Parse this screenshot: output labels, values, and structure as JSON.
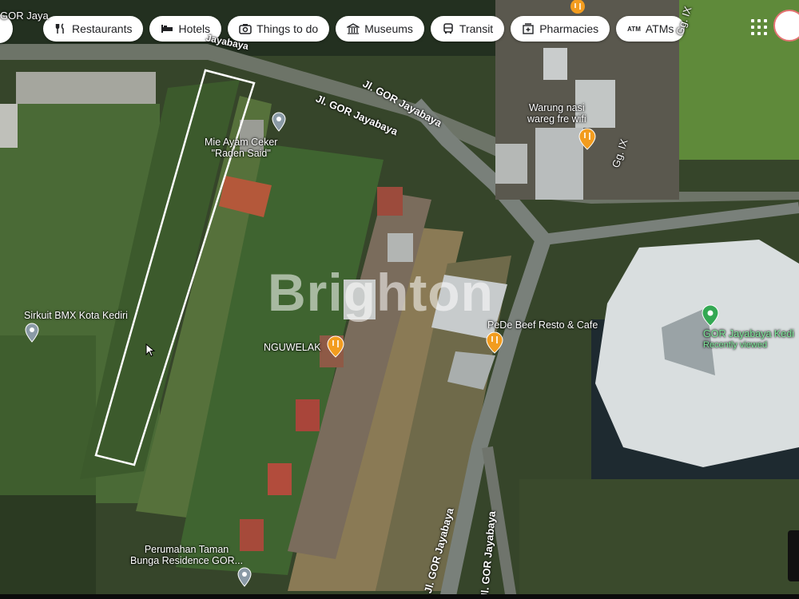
{
  "filters": [
    {
      "label": "Restaurants",
      "icon": "fork-knife-icon"
    },
    {
      "label": "Hotels",
      "icon": "bed-icon"
    },
    {
      "label": "Things to do",
      "icon": "camera-icon"
    },
    {
      "label": "Museums",
      "icon": "museum-icon"
    },
    {
      "label": "Transit",
      "icon": "bus-icon"
    },
    {
      "label": "Pharmacies",
      "icon": "pharmacy-icon"
    },
    {
      "label": "ATMs",
      "icon": "atm-icon"
    }
  ],
  "atm_glyph": "ATM",
  "top_left_fragment": "GOR Jaya",
  "roads": {
    "gor_jayabaya_top_fragment": "Jayabaya",
    "gor_jayabaya_1": "Jl. GOR Jayabaya",
    "gor_jayabaya_2": "Jl. GOR Jayabaya",
    "gor_jayabaya_3": "Jl. GOR Jayabaya",
    "gor_jayabaya_4": "Jl. GOR Jayabaya",
    "gg_ix_1": "Gg. IX",
    "gg_ix_2": "Gg. IX"
  },
  "places": {
    "mie_ayam": "Mie Ayam Ceker\n\"Raden Said\"",
    "warung": "Warung nasi\nwareg fre wifi",
    "sirkuit": "Sirkuit BMX Kota Kediri",
    "nguwelak": "NGUWELAK",
    "pede": "PeDe Beef Resto & Cafe",
    "gor": "GOR Jayabaya Kedi",
    "gor_sub": "Recently viewed",
    "perumahan": "Perumahan Taman\nBunga Residence GOR..."
  },
  "watermark": "Brighton",
  "colors": {
    "food_pin": "#f29c1f",
    "place_pin": "#8a9aa6",
    "gor_pin": "#34a853"
  }
}
